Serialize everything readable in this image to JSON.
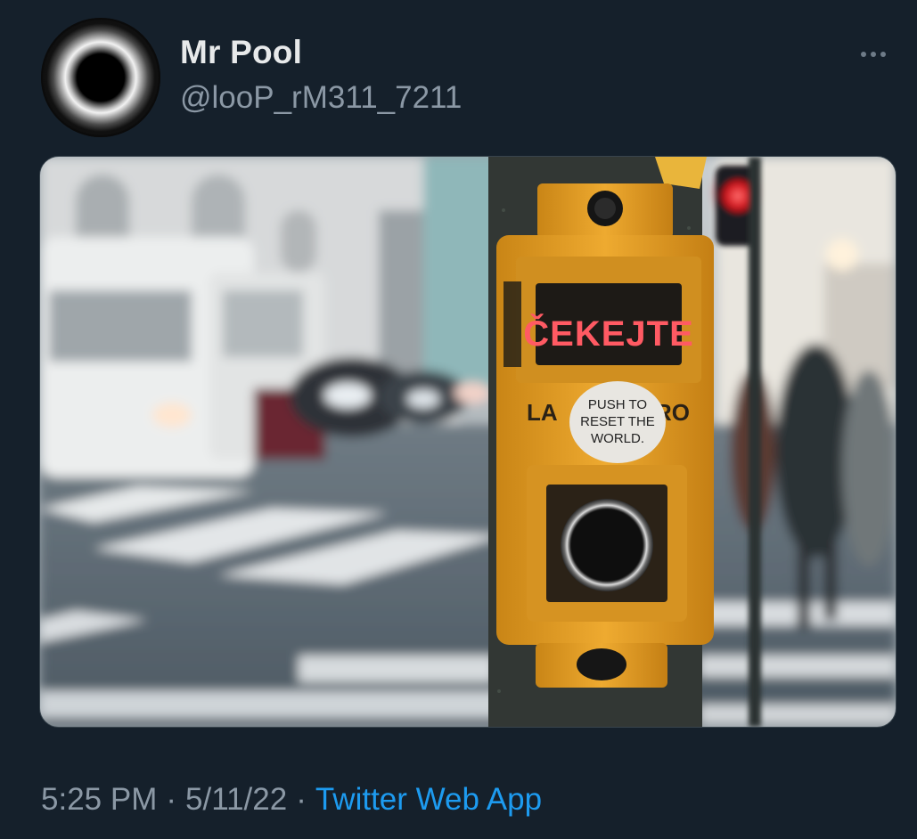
{
  "tweet": {
    "display_name": "Mr Pool",
    "handle": "@looP_rM311_7211",
    "time": "5:25 PM",
    "date": "5/11/22",
    "separator": "·",
    "source": "Twitter Web App",
    "more_icon": "more-horizontal-icon",
    "avatar_icon": "eclipse-avatar"
  },
  "media": {
    "display_text": "ČEKEJTE",
    "sticker_lines": [
      "PUSH TO",
      "RESET THE",
      "WORLD."
    ],
    "panel_left_text": "LA",
    "panel_right_text": "RO"
  },
  "colors": {
    "background": "#15202b",
    "link": "#1d9bf0",
    "secondary_text": "#8b98a5",
    "primary_text": "#e7e9ea",
    "button_box": "#e8a52a"
  }
}
